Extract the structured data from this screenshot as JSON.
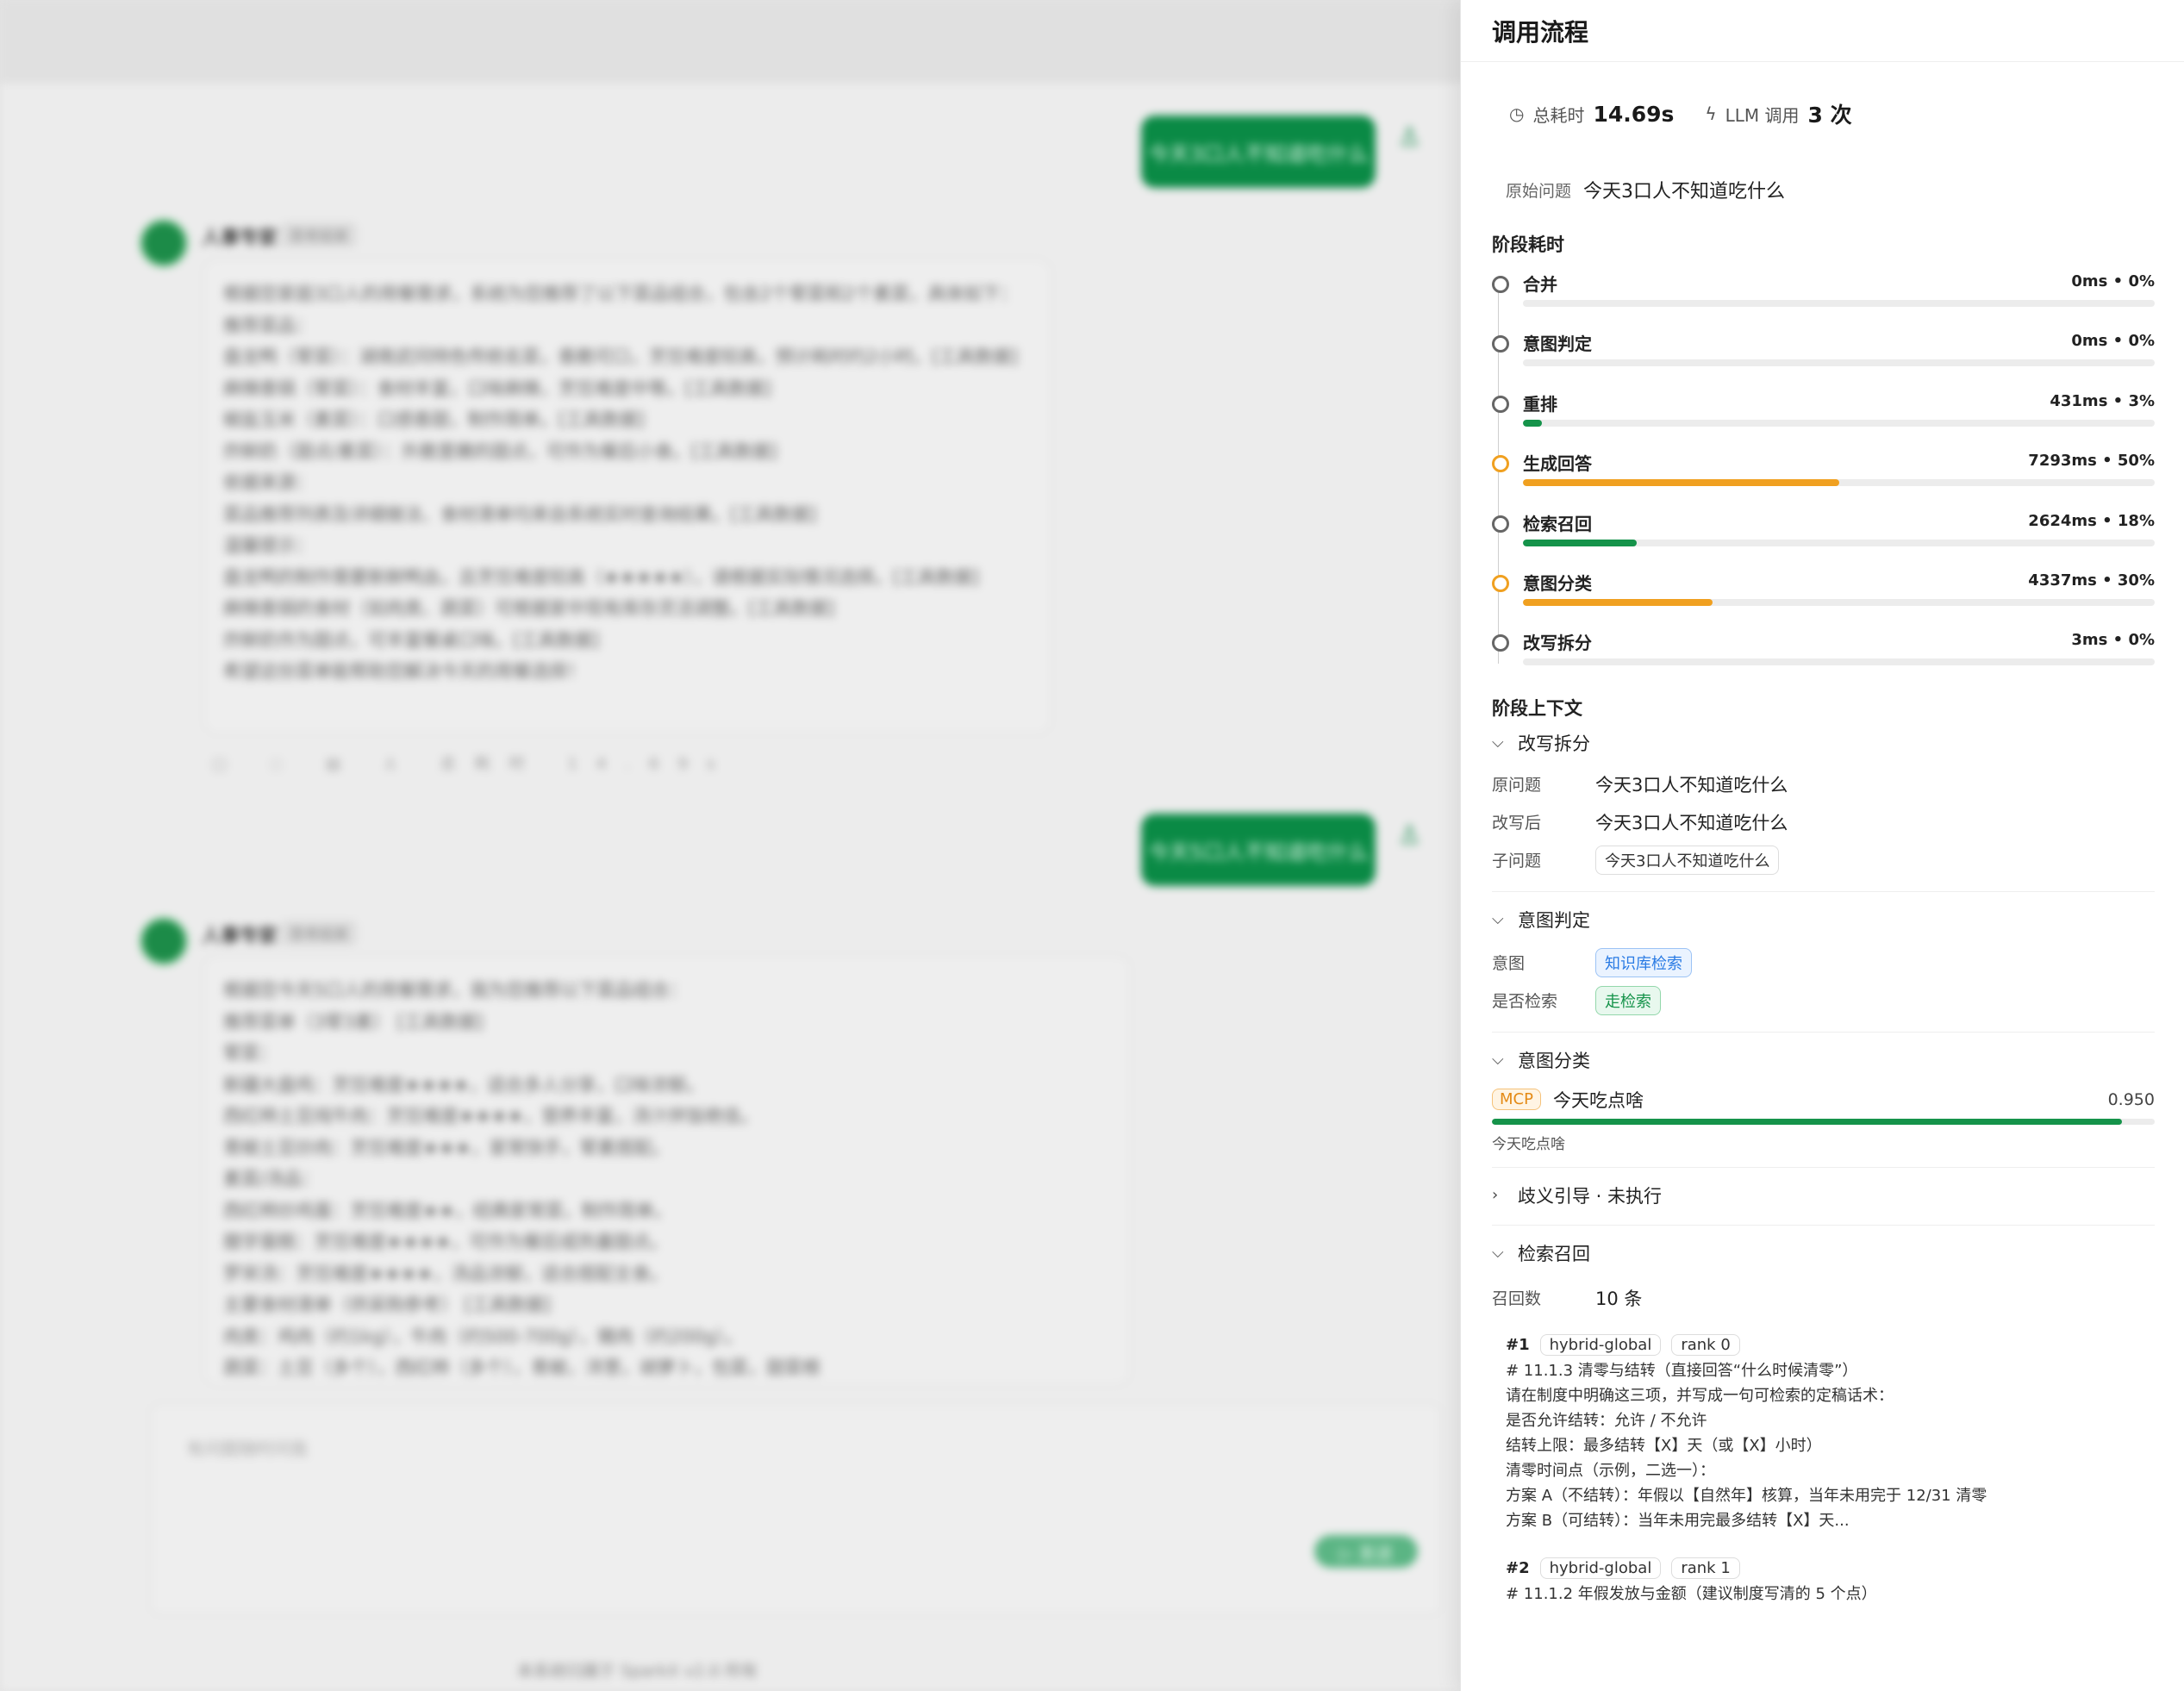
{
  "drawer": {
    "title": "调用流程",
    "total_time_label": "总耗时",
    "total_time_value": "14.69s",
    "llm_label": "LLM 调用",
    "llm_value": "3 次",
    "orig_question_label": "原始问题",
    "orig_question_value": "今天3口人不知道吃什么",
    "stage_section_title": "阶段耗时",
    "stages": [
      {
        "name": "合并",
        "meta": "0ms • 0%",
        "percent": 0,
        "status": "normal"
      },
      {
        "name": "意图判定",
        "meta": "0ms • 0%",
        "percent": 0,
        "status": "normal"
      },
      {
        "name": "重排",
        "meta": "431ms • 3%",
        "percent": 3,
        "status": "normal"
      },
      {
        "name": "生成回答",
        "meta": "7293ms • 50%",
        "percent": 50,
        "status": "warn"
      },
      {
        "name": "检索召回",
        "meta": "2624ms • 18%",
        "percent": 18,
        "status": "normal"
      },
      {
        "name": "意图分类",
        "meta": "4337ms • 30%",
        "percent": 30,
        "status": "warn"
      },
      {
        "name": "改写拆分",
        "meta": "3ms • 0%",
        "percent": 0,
        "status": "normal"
      }
    ],
    "colors": {
      "normal": "#15934a",
      "warn": "#f0a020"
    },
    "context_title": "阶段上下文",
    "rewrite": {
      "head": "改写拆分",
      "orig_label": "原问题",
      "orig_value": "今天3口人不知道吃什么",
      "after_label": "改写后",
      "after_value": "今天3口人不知道吃什么",
      "sub_label": "子问题",
      "sub_value": "今天3口人不知道吃什么"
    },
    "judge": {
      "head": "意图判定",
      "intent_label": "意图",
      "intent_value": "知识库检索",
      "retrieve_label": "是否检索",
      "retrieve_value": "走检索"
    },
    "classify": {
      "head": "意图分类",
      "badge": "MCP",
      "name": "今天吃点啥",
      "score": "0.950",
      "score_value": 0.95,
      "sub": "今天吃点啥"
    },
    "ambiguity_head": "歧义引导 · 未执行",
    "retrieval": {
      "head": "检索召回",
      "count_label": "召回数",
      "count_value": "10 条",
      "docs": [
        {
          "idx": "#1",
          "source": "hybrid-global",
          "rank": "rank 0",
          "lines": [
            "# 11.1.3 清零与结转（直接回答“什么时候清零”）",
            "请在制度中明确这三项，并写成一句可检索的定稿话术：",
            "是否允许结转：允许 / 不允许",
            "结转上限：最多结转【X】天（或【X】小时）",
            "清零时间点（示例，二选一）：",
            "方案 A（不结转）：年假以【自然年】核算，当年未用完于 12/31 清零",
            "方案 B（可结转）：当年未用完最多结转【X】天..."
          ]
        },
        {
          "idx": "#2",
          "source": "hybrid-global",
          "rank": "rank 1",
          "lines": [
            "# 11.1.2 年假发放与金额（建议制度写清的 5 个点）"
          ]
        }
      ]
    }
  },
  "background": {
    "user_message_1": "今天3口人不知道吃什么",
    "user_message_2": "今天5口人不知道吃什么",
    "bot_name": "人事专家",
    "bot_tag": "思考结束",
    "reply1_lines": [
      "根据您家庭3口人的用餐需求，系统为您推荐了以下菜品组合，包含2个荤菜和2个素菜，具体如下：",
      "推荐菜品：",
      "盘龙鸭（荤菜）：湖南武冈特色传统名菜，香脆可口，烹饪难度较高，预计耗时约2小时。[工具数据]",
      "麻辣香锅（荤菜）：食材丰富，口味麻辣，烹饪难度中等。[工具数据]",
      "椒盐玉米（素菜）：口感香甜，制作简单。[工具数据]",
      "炸鲜奶（甜点/素菜）：外脆里嫩的甜点，可作为餐后小食。[工具数据]",
      "依据来源：",
      "菜品推荐列表及详细做法、食材清单均来自系统实时查询结果。[工具数据]",
      "温馨提示：",
      "盘龙鸭的制作需要新鲜鸭血，且烹饪难度较高（★★★★★），请根据实际情况选择。[工具数据]",
      "麻辣香锅的食材（如肉类、蔬菜）可根据家中现有库存灵活调整。[工具数据]",
      "炸鲜奶作为甜点，可丰富餐桌口味。[工具数据]",
      "希望这份菜单能帮助您解决今天的用餐选择！"
    ],
    "reply1_tools": "▢ ◌ ▤ ♙ 总耗时 14.69s",
    "reply2_lines": [
      "根据您今天5口人的用餐需求，我为您推荐以下菜品组合：",
      "推荐菜单（3荤3素） [工具数据]",
      "荤菜：",
      "新疆大盘鸡：烹饪难度★★★★，适合多人分享，口味浓郁。",
      "西红柿土豆炖牛肉：烹饪难度★★★★，营养丰富，汤汁拌饭绝佳。",
      "青椒土豆炒肉：烹饪难度★★★，家常快手，荤素搭配。",
      "素菜/汤品：",
      "西红柿炒鸡蛋：烹饪难度★★，经典家常菜，制作简单。",
      "腊学蛋糕：烹饪难度★★★★，可作为餐后或热量甜点。",
      "罗宋汤：烹饪难度★★★★，汤品浓郁，适合搭配主食。",
      "主要食材清单（供采购参考） [工具数据]",
      "肉类：鸡肉（约1kg），牛肉（约500-700g），猪肉（约200g）。",
      "蔬菜：土豆（多个），西红柿（多个），青椒，洋葱，胡萝卜，包菜，甜菜根"
    ],
    "composer_placeholder": "有问题随时问我",
    "send_label": "▷ 发送",
    "footer": "本系统归属于 SparkX v2.0 所有"
  }
}
